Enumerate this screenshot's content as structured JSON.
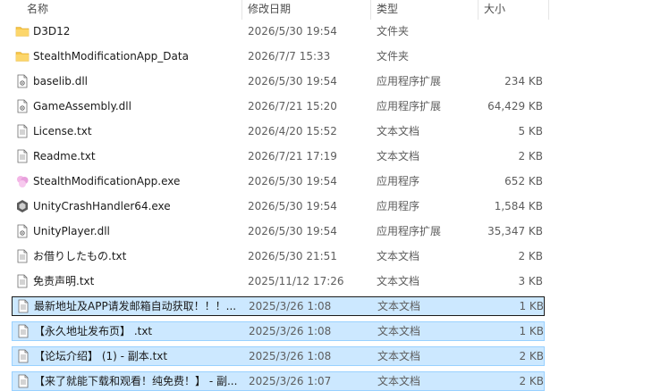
{
  "columns": {
    "name": "名称",
    "date": "修改日期",
    "type": "类型",
    "size": "大小"
  },
  "files": [
    {
      "name": "D3D12",
      "date": "2026/5/30 19:54",
      "type": "文件夹",
      "size": "",
      "icon": "folder-icon"
    },
    {
      "name": "StealthModificationApp_Data",
      "date": "2026/7/7 15:33",
      "type": "文件夹",
      "size": "",
      "icon": "folder-icon"
    },
    {
      "name": "baselib.dll",
      "date": "2026/5/30 19:54",
      "type": "应用程序扩展",
      "size": "234 KB",
      "icon": "dll-file-icon"
    },
    {
      "name": "GameAssembly.dll",
      "date": "2026/7/21 15:20",
      "type": "应用程序扩展",
      "size": "64,429 KB",
      "icon": "dll-file-icon"
    },
    {
      "name": "License.txt",
      "date": "2026/4/20 15:52",
      "type": "文本文档",
      "size": "5 KB",
      "icon": "text-file-icon"
    },
    {
      "name": "Readme.txt",
      "date": "2026/7/21 17:19",
      "type": "文本文档",
      "size": "2 KB",
      "icon": "text-file-icon"
    },
    {
      "name": "StealthModificationApp.exe",
      "date": "2026/5/30 19:54",
      "type": "应用程序",
      "size": "652 KB",
      "icon": "app-exe-icon"
    },
    {
      "name": "UnityCrashHandler64.exe",
      "date": "2026/5/30 19:54",
      "type": "应用程序",
      "size": "1,584 KB",
      "icon": "unity-exe-icon"
    },
    {
      "name": "UnityPlayer.dll",
      "date": "2026/5/30 19:54",
      "type": "应用程序扩展",
      "size": "35,347 KB",
      "icon": "dll-file-icon"
    },
    {
      "name": "お借りしたもの.txt",
      "date": "2026/5/30 21:51",
      "type": "文本文档",
      "size": "2 KB",
      "icon": "text-file-icon"
    },
    {
      "name": "免责声明.txt",
      "date": "2025/11/12 17:26",
      "type": "文本文档",
      "size": "3 KB",
      "icon": "text-file-icon"
    },
    {
      "name": "最新地址及APP请发邮箱自动获取！！！...",
      "date": "2025/3/26 1:08",
      "type": "文本文档",
      "size": "1 KB",
      "icon": "text-file-icon"
    },
    {
      "name": "【永久地址发布页】 .txt",
      "date": "2025/3/26 1:08",
      "type": "文本文档",
      "size": "1 KB",
      "icon": "text-file-icon"
    },
    {
      "name": "【论坛介绍】 (1) - 副本.txt",
      "date": "2025/3/26 1:08",
      "type": "文本文档",
      "size": "2 KB",
      "icon": "text-file-icon"
    },
    {
      "name": "【来了就能下载和观看！纯免费！】 - 副...",
      "date": "2025/3/26 1:07",
      "type": "文本文档",
      "size": "2 KB",
      "icon": "text-file-icon"
    }
  ],
  "colors": {
    "selection_bg": "#cce8ff",
    "selection_border": "#99d1ff",
    "folder": "#f8c648"
  }
}
